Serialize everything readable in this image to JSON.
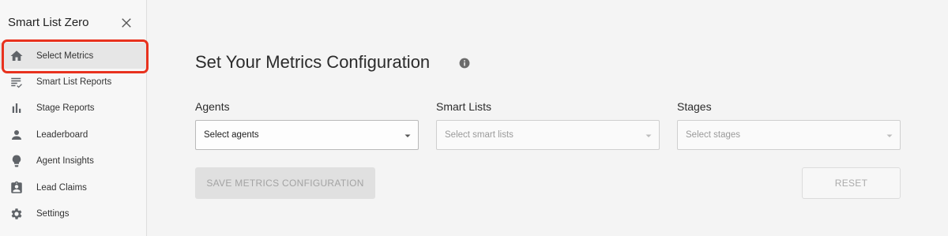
{
  "sidebar": {
    "app_title": "Smart List Zero",
    "close_icon": "close-icon",
    "items": [
      {
        "label": "Select Metrics",
        "icon": "home-icon",
        "active": true
      },
      {
        "label": "Smart List Reports",
        "icon": "list-check-icon",
        "active": false
      },
      {
        "label": "Stage Reports",
        "icon": "bar-chart-icon",
        "active": false
      },
      {
        "label": "Leaderboard",
        "icon": "person-icon",
        "active": false
      },
      {
        "label": "Agent Insights",
        "icon": "lightbulb-icon",
        "active": false
      },
      {
        "label": "Lead Claims",
        "icon": "assignment-ind-icon",
        "active": false
      },
      {
        "label": "Settings",
        "icon": "gear-icon",
        "active": false
      }
    ],
    "highlight_color": "#e8321e"
  },
  "main": {
    "title": "Set Your Metrics Configuration",
    "info_icon": "info-icon",
    "fields": [
      {
        "label": "Agents",
        "value": "Select agents",
        "enabled": true
      },
      {
        "label": "Smart Lists",
        "value": "Select smart lists",
        "enabled": false
      },
      {
        "label": "Stages",
        "value": "Select stages",
        "enabled": false
      }
    ],
    "save_button": "SAVE METRICS CONFIGURATION",
    "reset_button": "RESET"
  }
}
